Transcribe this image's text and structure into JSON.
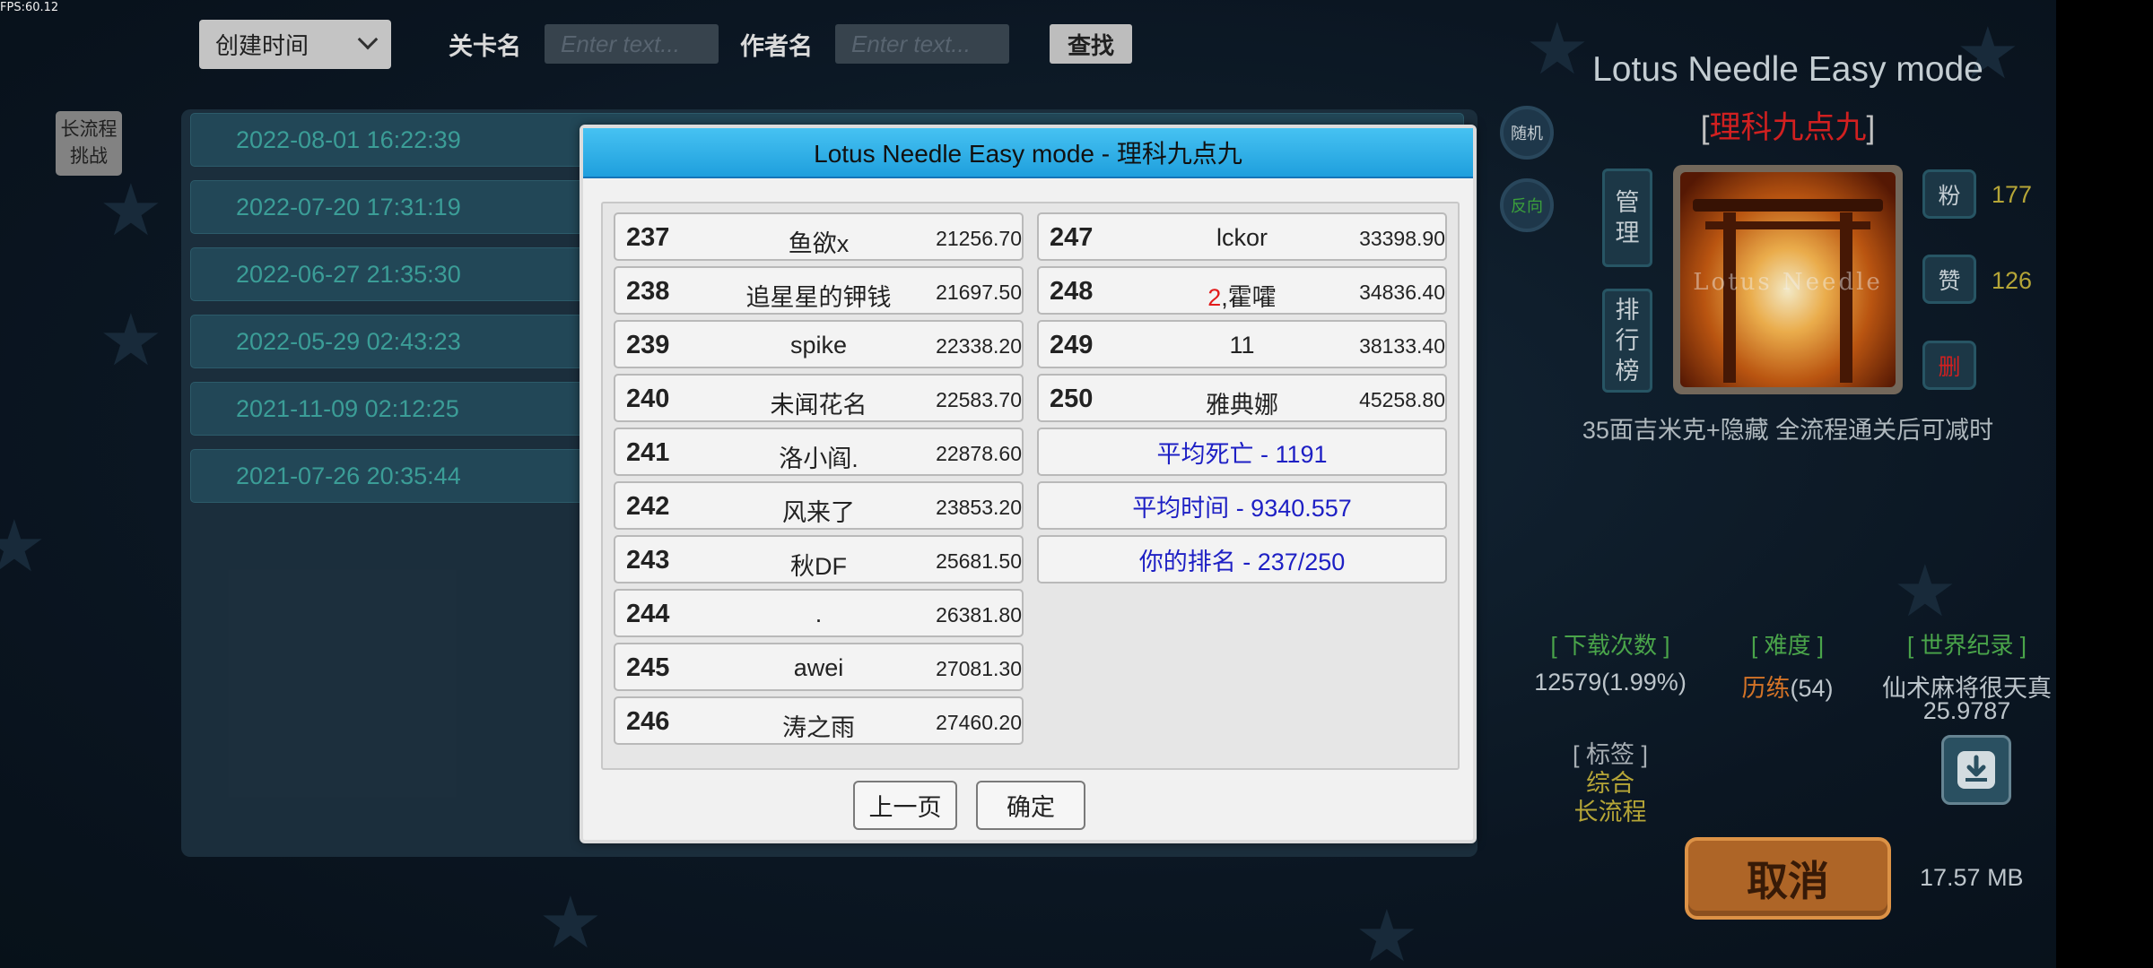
{
  "fps": "FPS:60.12",
  "filters": {
    "sort_value": "创建时间",
    "level_label": "关卡名",
    "level_placeholder": "Enter text...",
    "author_label": "作者名",
    "author_placeholder": "Enter text...",
    "search_label": "查找"
  },
  "side_button": "长流程\n挑战",
  "list": [
    "2022-08-01 16:22:39",
    "2022-07-20 17:31:19",
    "2022-06-27 21:35:30",
    "2022-05-29 02:43:23",
    "2021-11-09 02:12:25",
    "2021-07-26 20:35:44"
  ],
  "round_buttons": {
    "random": "随机",
    "reverse": "反向"
  },
  "detail": {
    "title": "Lotus Needle Easy mode",
    "author": "理科九点九",
    "manage": "管理",
    "ranking": "排行榜",
    "thumb_watermark": "Lotus Needle",
    "fans_icon": "粉",
    "fans": "177",
    "likes_icon": "赞",
    "likes": "126",
    "delete_icon": "删",
    "description": "35面吉米克+隐藏 全流程通关后可减时",
    "downloads_head": "[ 下载次数 ]",
    "downloads": "12579(1.99%)",
    "difficulty_head": "[ 难度 ]",
    "difficulty_word": "历练",
    "difficulty_num": "(54)",
    "record_head": "[ 世界纪录 ]",
    "record_holder": "仙术麻将很天真",
    "record_time": "25.9787",
    "tags_head": "[ 标签 ]",
    "tags": [
      "综合",
      "长流程"
    ],
    "cancel": "取消",
    "size": "17.57 MB",
    "colors": {
      "author": "#dd2222",
      "difficulty": "#e07a2a",
      "headings": "#4fae4f",
      "tags": "#bfae3a"
    }
  },
  "modal": {
    "title": "Lotus Needle Easy mode - 理科九点九",
    "left": [
      {
        "rank": "237",
        "name": "鱼欲x",
        "time": "21256.70"
      },
      {
        "rank": "238",
        "name": "追星星的钾钱",
        "time": "21697.50"
      },
      {
        "rank": "239",
        "name": "spike",
        "time": "22338.20"
      },
      {
        "rank": "240",
        "name": "未闻花名",
        "time": "22583.70"
      },
      {
        "rank": "241",
        "name": "洛小阎.",
        "time": "22878.60"
      },
      {
        "rank": "242",
        "name": "风来了",
        "time": "23853.20"
      },
      {
        "rank": "243",
        "name": "秋DF",
        "time": "25681.50"
      },
      {
        "rank": "244",
        "name": ".",
        "time": "26381.80"
      },
      {
        "rank": "245",
        "name": "awei",
        "time": "27081.30"
      },
      {
        "rank": "246",
        "name": "涛之雨",
        "time": "27460.20"
      }
    ],
    "right": [
      {
        "rank": "247",
        "name": "lckor",
        "time": "33398.90"
      },
      {
        "rank": "248",
        "name_red": "2",
        "name": ",霍嚯",
        "time": "34836.40"
      },
      {
        "rank": "249",
        "name": "11",
        "time": "38133.40"
      },
      {
        "rank": "250",
        "name": "雅典娜",
        "time": "45258.80"
      }
    ],
    "summary": {
      "avg_deaths": "平均死亡 - 1191",
      "avg_time": "平均时间 - 9340.557",
      "your_rank": "你的排名 - 237/250"
    },
    "prev_button": "上一页",
    "ok_button": "确定"
  }
}
